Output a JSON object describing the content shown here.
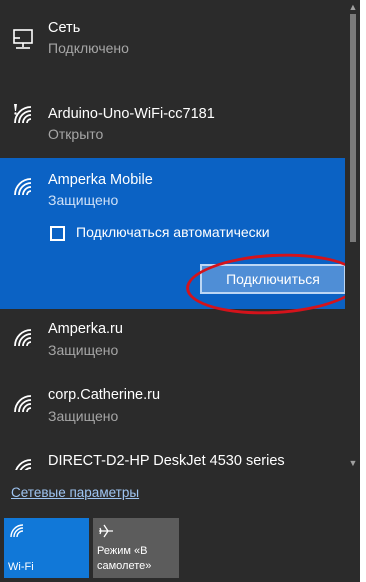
{
  "networks": [
    {
      "name": "Сеть",
      "status": "Подключено",
      "icon": "network-icon"
    },
    {
      "name": "Arduino-Uno-WiFi-cc7181",
      "status": "Открыто",
      "icon": "wifi-open-icon"
    },
    {
      "name": "Amperka Mobile",
      "status": "Защищено",
      "icon": "wifi-icon"
    },
    {
      "name": "Amperka.ru",
      "status": "Защищено",
      "icon": "wifi-icon"
    },
    {
      "name": "corp.Catherine.ru",
      "status": "Защищено",
      "icon": "wifi-icon"
    },
    {
      "name": "DIRECT-D2-HP DeskJet 4530 series",
      "status": "",
      "icon": "wifi-icon"
    }
  ],
  "selected": {
    "auto_connect_label": "Подключаться автоматически",
    "auto_connect_checked": false,
    "connect_button": "Подключиться"
  },
  "settings_link": "Сетевые параметры",
  "quick_actions": {
    "wifi_label": "Wi-Fi",
    "airplane_line1": "Режим «В",
    "airplane_line2": "самолете»"
  },
  "colors": {
    "panel_bg": "#2b2b2b",
    "selected_bg": "#0b62c4",
    "wifi_tile": "#1178d8",
    "highlight_ring": "#d4131b",
    "link": "#9fc5f2"
  }
}
